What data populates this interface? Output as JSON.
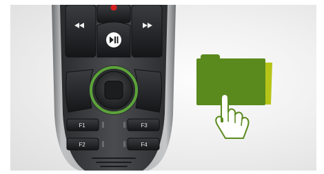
{
  "device": {
    "keys": {
      "rewind_icon": "rewind-icon",
      "fast_forward_icon": "fast-forward-icon",
      "play_pause_icon": "play-pause-icon",
      "f1_label": "F1",
      "f2_label": "F2",
      "f3_label": "F3",
      "f4_label": "F4"
    },
    "colors": {
      "body": "#3a3c3e",
      "frame": "#9a9c9e",
      "key": "#1f2123",
      "ring": "#5ca33a",
      "record_led": "#d42020"
    }
  },
  "folder": {
    "icon": "folder-icon",
    "pointer_icon": "hand-pointer-icon",
    "colors": {
      "front": "#5a8a1e",
      "back": "#b6c418",
      "hand_stroke": "#5a8a1e"
    }
  }
}
